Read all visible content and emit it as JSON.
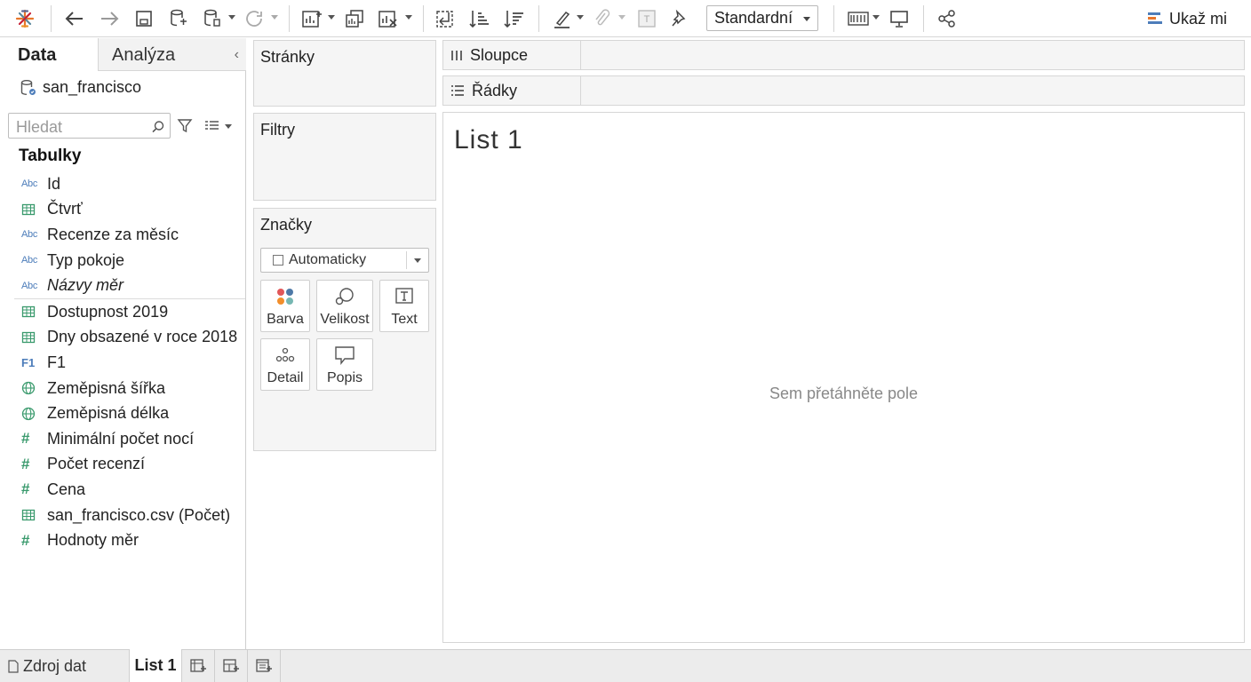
{
  "toolbar": {
    "fit_select": {
      "value": "Standardní"
    },
    "show_me_label": "Ukaž mi",
    "icons": [
      "tableau-logo-icon",
      "undo-icon",
      "redo-icon",
      "save-icon",
      "new-data-source-icon",
      "pause-auto-update-icon",
      "refresh-icon",
      "new-worksheet-icon",
      "duplicate-sheet-icon",
      "clear-sheet-icon",
      "swap-rows-columns-icon",
      "sort-ascending-icon",
      "sort-descending-icon",
      "highlight-icon",
      "group-icon",
      "show-labels-icon",
      "fix-axes-icon",
      "show-cards-icon",
      "presentation-mode-icon",
      "share-icon"
    ]
  },
  "data_pane": {
    "tabs": {
      "data": "Data",
      "analysis": "Analýza"
    },
    "data_source": "san_francisco",
    "search": {
      "placeholder": "Hledat"
    },
    "section_title": "Tabulky",
    "fields": [
      {
        "name": "Id",
        "type": "abc",
        "icon": "Abc"
      },
      {
        "name": "Čtvrť",
        "type": "table",
        "icon": "table-icon"
      },
      {
        "name": "Recenze za měsíc",
        "type": "abc",
        "icon": "Abc"
      },
      {
        "name": "Typ pokoje",
        "type": "abc",
        "icon": "Abc"
      },
      {
        "name": "Názvy měr",
        "type": "abc",
        "icon": "Abc",
        "italic": true
      },
      {
        "name": "Dostupnost 2019",
        "type": "table",
        "icon": "table-icon",
        "separator_before": true
      },
      {
        "name": "Dny obsazené v roce 2018",
        "type": "table",
        "icon": "table-icon"
      },
      {
        "name": "F1",
        "type": "f1",
        "icon": "F1"
      },
      {
        "name": "Zeměpisná šířka",
        "type": "geo",
        "icon": "globe-icon"
      },
      {
        "name": "Zeměpisná délka",
        "type": "geo",
        "icon": "globe-icon"
      },
      {
        "name": "Minimální počet nocí",
        "type": "num",
        "icon": "#"
      },
      {
        "name": "Počet recenzí",
        "type": "num",
        "icon": "#"
      },
      {
        "name": "Cena",
        "type": "num",
        "icon": "#"
      },
      {
        "name": "san_francisco.csv (Počet)",
        "type": "table",
        "icon": "table-icon"
      },
      {
        "name": "Hodnoty měr",
        "type": "num",
        "icon": "#"
      }
    ]
  },
  "shelves": {
    "pages": "Stránky",
    "filters": "Filtry",
    "columns": "Sloupce",
    "rows": "Řádky"
  },
  "marks": {
    "title": "Značky",
    "type_select": "Automaticky",
    "buttons": {
      "color": "Barva",
      "size": "Velikost",
      "text": "Text",
      "detail": "Detail",
      "tooltip": "Popis"
    }
  },
  "view": {
    "title": "List 1",
    "drop_hint": "Sem přetáhněte pole"
  },
  "tabbar": {
    "data_source": "Zdroj dat",
    "sheet": "List 1"
  },
  "colors": {
    "accent_blue": "#4d7dba",
    "measure_green": "#3a9a6d",
    "panel_bg": "#f5f5f5"
  }
}
